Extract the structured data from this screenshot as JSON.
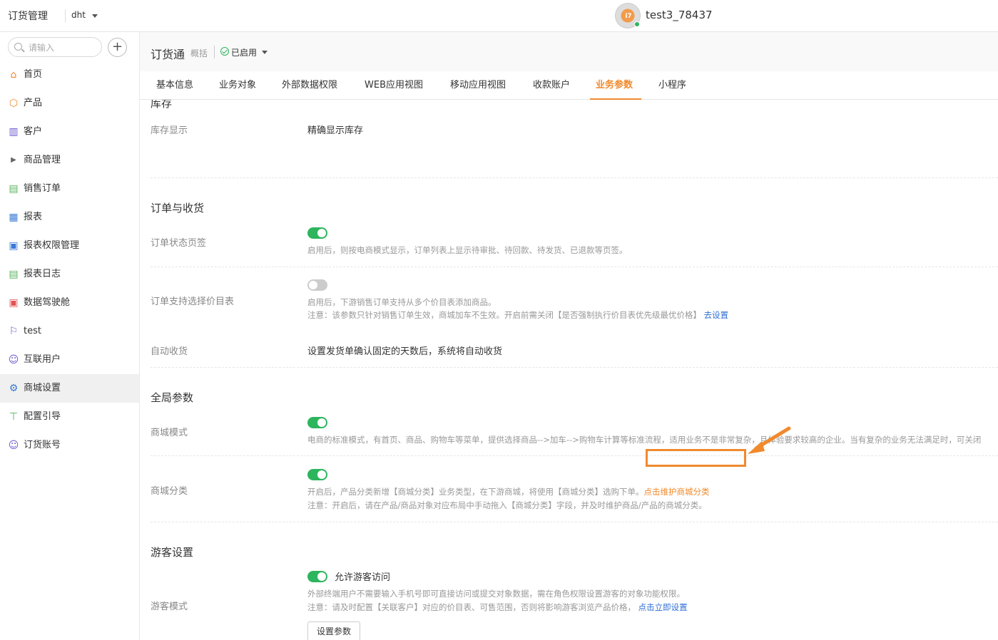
{
  "topbar": {
    "app_title": "订货管理",
    "tenant": "dht",
    "avatar_text": "i7",
    "username": "test3_78437"
  },
  "sidebar": {
    "search_placeholder": "请输入",
    "add_symbol": "+",
    "items": [
      {
        "label": "首页",
        "icon": "home-icon"
      },
      {
        "label": "产品",
        "icon": "box-icon"
      },
      {
        "label": "客户",
        "icon": "building-icon"
      },
      {
        "label": "商品管理",
        "icon": "caret-right-icon"
      },
      {
        "label": "销售订单",
        "icon": "clipboard-icon"
      },
      {
        "label": "报表",
        "icon": "calendar-icon"
      },
      {
        "label": "报表权限管理",
        "icon": "report-lock-icon"
      },
      {
        "label": "报表日志",
        "icon": "report-log-icon"
      },
      {
        "label": "数据驾驶舱",
        "icon": "dashboard-icon"
      },
      {
        "label": "test",
        "icon": "flag-icon"
      },
      {
        "label": "互联用户",
        "icon": "users-icon"
      },
      {
        "label": "商城设置",
        "icon": "settings-icon"
      },
      {
        "label": "配置引导",
        "icon": "signpost-icon"
      },
      {
        "label": "订货账号",
        "icon": "account-icon"
      }
    ],
    "active_item": "商城设置"
  },
  "header": {
    "title": "订货通",
    "subtitle": "概括",
    "status": "已启用"
  },
  "tabs": [
    {
      "label": "基本信息"
    },
    {
      "label": "业务对象"
    },
    {
      "label": "外部数据权限"
    },
    {
      "label": "WEB应用视图"
    },
    {
      "label": "移动应用视图"
    },
    {
      "label": "收款账户"
    },
    {
      "label": "业务参数"
    },
    {
      "label": "小程序"
    }
  ],
  "active_tab": "业务参数",
  "sections": {
    "inventory": {
      "title": "库存",
      "stock_display_label": "库存显示",
      "stock_display_value": "精确显示库存"
    },
    "order": {
      "title": "订单与收货",
      "status_tabs_label": "订单状态页签",
      "status_tabs_on": true,
      "status_tabs_desc": "启用后，则按电商模式显示，订单列表上显示待审批、待回款、待发货、已退款等页签。",
      "pricebook_label": "订单支持选择价目表",
      "pricebook_on": false,
      "pricebook_desc1": "启用后，下游销售订单支持从多个价目表添加商品。",
      "pricebook_desc2": "注意：该参数只针对销售订单生效，商城加车不生效。开启前需关闭【是否强制执行价目表优先级最优价格】",
      "pricebook_link": "去设置",
      "auto_receive_label": "自动收货",
      "auto_receive_value": "设置发货单确认固定的天数后，系统将自动收货"
    },
    "global": {
      "title": "全局参数",
      "mall_mode_label": "商城模式",
      "mall_mode_on": true,
      "mall_mode_desc": "电商的标准模式，有首页、商品、购物车等菜单，提供选择商品-->加车-->购物车计算等标准流程，适用业务不是非常复杂，且体验要求较高的企业。当有复杂的业务无法满足时，可关闭",
      "mall_category_label": "商城分类",
      "mall_category_on": true,
      "mall_category_desc1": "开启后，产品分类新增【商城分类】业务类型，在下游商城，将使用【商城分类】选购下单。",
      "mall_category_link": "点击维护商城分类",
      "mall_category_desc2": "注意：开启后，请在产品/商品对象对应布局中手动拖入【商城分类】字段，并及时维护商品/产品的商城分类。"
    },
    "guest": {
      "title": "游客设置",
      "guest_mode_label": "游客模式",
      "guest_mode_on": true,
      "allow_label": "允许游客访问",
      "desc1": "外部终端用户不需要输入手机号即可直接访问或提交对象数据，需在角色权限设置游客的对象功能权限。",
      "desc2": "注意：请及时配置【关联客户】对应的价目表、可售范围，否则将影响游客浏览产品价格，",
      "link": "点击立即设置",
      "button": "设置参数"
    }
  },
  "colors": {
    "accent": "#f08a2d",
    "toggle_on": "#2db55d",
    "link": "#2f6fd6"
  }
}
